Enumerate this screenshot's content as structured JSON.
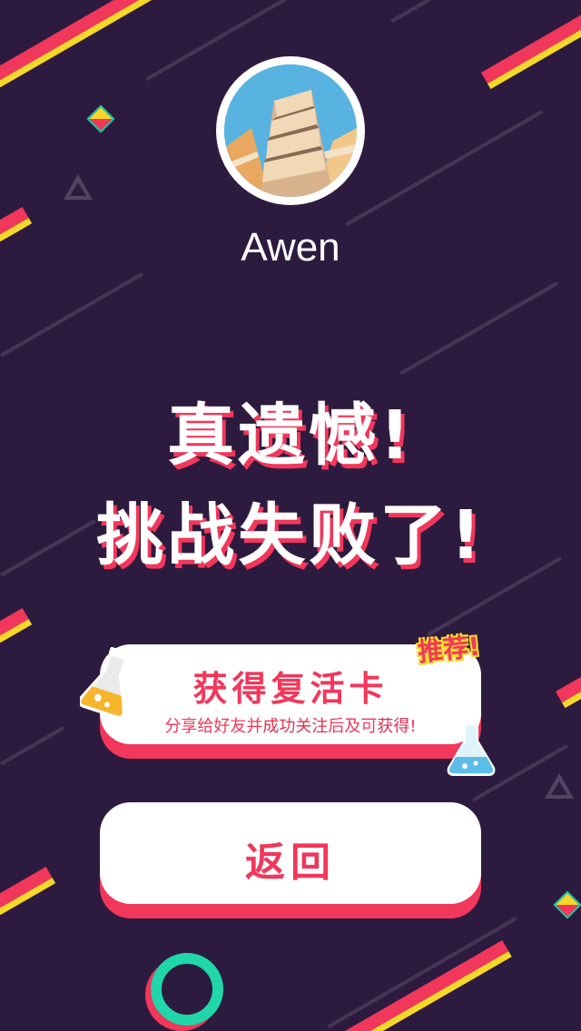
{
  "user": {
    "name": "Awen"
  },
  "result": {
    "line1": "真遗憾!",
    "line2": "挑战失败了!"
  },
  "revive_card": {
    "title": "获得复活卡",
    "badge": "推荐!",
    "subtitle_parts": [
      "分享给好友并",
      "成功关注",
      "后及可",
      "获得",
      "!"
    ]
  },
  "back_button": {
    "label": "返回"
  },
  "colors": {
    "background": "#2d1b3f",
    "accent_red": "#f1375b",
    "accent_yellow": "#f6d82b",
    "accent_teal": "#21d6a9",
    "button_bg": "#ffffff"
  },
  "icons": {
    "avatar": "building-photo-avatar",
    "left_flask": "flask-icon",
    "right_flask": "erlenmeyer-flask-icon"
  }
}
